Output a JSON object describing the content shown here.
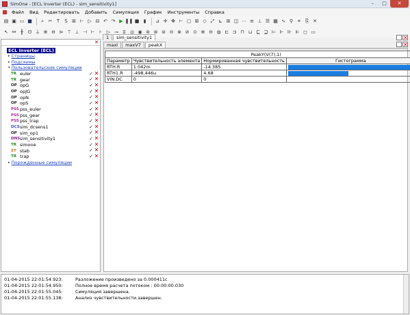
{
  "window": {
    "title": "SimOne - [ECL Inverter (ECL) - sim_sensitivity1]"
  },
  "menu": [
    "Файл",
    "Вид",
    "Редактировать",
    "Добавить",
    "Симуляция",
    "График",
    "Инструменты",
    "Справка"
  ],
  "tree": {
    "root": "ECL Inverter (ECL)",
    "pages": "Страницы",
    "subcircuits": "Подсхемы",
    "user_sims": "Пользовательские симуляции",
    "generated": "Порожденные симуляции",
    "sims": [
      {
        "badge": "TR",
        "cls": "b-tr",
        "name": "euler"
      },
      {
        "badge": "TR",
        "cls": "b-tr",
        "name": "gear"
      },
      {
        "badge": "OP",
        "cls": "b-op",
        "name": "opG"
      },
      {
        "badge": "OP",
        "cls": "b-op",
        "name": "opJG"
      },
      {
        "badge": "OP",
        "cls": "b-op",
        "name": "opN"
      },
      {
        "badge": "OP",
        "cls": "b-op",
        "name": "opS"
      },
      {
        "badge": "PSS",
        "cls": "b-pss",
        "name": "pss_euler"
      },
      {
        "badge": "PSS",
        "cls": "b-pss",
        "name": "pss_gear"
      },
      {
        "badge": "PSS",
        "cls": "b-pss",
        "name": "pss_trap"
      },
      {
        "badge": "DCS",
        "cls": "b-dcs",
        "name": "sim_dcsens1"
      },
      {
        "badge": "OP",
        "cls": "b-op",
        "name": "sim_op1"
      },
      {
        "badge": "DNS",
        "cls": "b-dns",
        "name": "sim_sensitivity1"
      },
      {
        "badge": "TR",
        "cls": "b-tr",
        "name": "simone"
      },
      {
        "badge": "ST",
        "cls": "b-st",
        "name": "stab"
      },
      {
        "badge": "TR",
        "cls": "b-tr",
        "name": "trap"
      }
    ]
  },
  "tabs": {
    "top": [
      "1",
      "sim_sensitivity1"
    ],
    "sub": [
      "maxI",
      "maxV7",
      "peakX"
    ]
  },
  "table": {
    "title": "PeakY(V(7),1)",
    "headers": [
      "Параметр",
      "Чувствительность элемента",
      "Нормированная чувствительность",
      "Гистограмма",
      "%"
    ],
    "rows": [
      {
        "param": "RTH.R",
        "sens": "1.042m",
        "norm": "-14.385",
        "pct": 100
      },
      {
        "param": "RTH1.R",
        "sens": "-498.446u",
        "norm": "4.68",
        "pct": 48
      },
      {
        "param": "VIN.DC",
        "sens": "0",
        "norm": "0",
        "pct": 0
      }
    ]
  },
  "log": [
    {
      "ts": "01-04-2015 22:01:54.923:",
      "msg": "Разложение произведено за 0.000411с"
    },
    {
      "ts": "01-04-2015 22:01:54.950:",
      "msg": "Полное время расчета потоком : 00:00:00.030"
    },
    {
      "ts": "01-04-2015 22:01:55.045:",
      "msg": "Симуляция завершена."
    },
    {
      "ts": "01-04-2015 22:01:55.138:",
      "msg": "Анализ чувствительности завершен."
    }
  ]
}
